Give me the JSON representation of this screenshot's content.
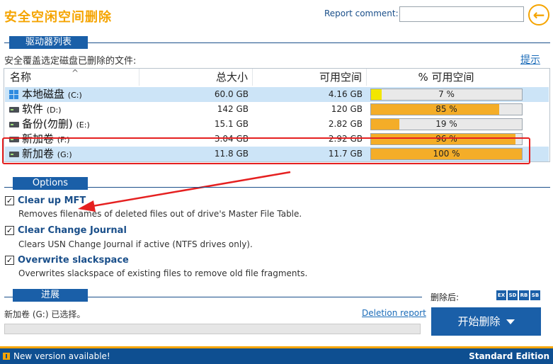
{
  "window": {
    "title": "安全空闲空间删除"
  },
  "report_comment": {
    "label": "Report comment:",
    "value": ""
  },
  "back_button": {
    "icon": "arrow-left-icon",
    "glyph": "←"
  },
  "drives_section": {
    "tab_label": "驱动器列表",
    "subheading": "安全覆盖选定磁盘已删除的文件:",
    "hint_link": "提示",
    "columns": [
      "名称",
      "总大小",
      "可用空间",
      "% 可用空间"
    ],
    "rows": [
      {
        "name": "本地磁盘",
        "letter": "(C:)",
        "total": "60.0 GB",
        "free": "4.16 GB",
        "pct_label": "7 %",
        "pct": 7,
        "bar_color": "#f2e600",
        "icon": "windows-drive-icon",
        "selected": true
      },
      {
        "name": "软件",
        "letter": "(D:)",
        "total": "142 GB",
        "free": "120 GB",
        "pct_label": "85 %",
        "pct": 85,
        "bar_color": "#f4ad28",
        "icon": "drive-icon",
        "selected": false
      },
      {
        "name": "备份(勿删)",
        "letter": "(E:)",
        "total": "15.1 GB",
        "free": "2.82 GB",
        "pct_label": "19 %",
        "pct": 19,
        "bar_color": "#f4ad28",
        "icon": "drive-icon",
        "selected": false
      },
      {
        "name": "新加卷",
        "letter": "(F:)",
        "total": "3.04 GB",
        "free": "2.92 GB",
        "pct_label": "96 %",
        "pct": 96,
        "bar_color": "#f4ad28",
        "icon": "drive-icon",
        "selected": false
      },
      {
        "name": "新加卷",
        "letter": "(G:)",
        "total": "11.8 GB",
        "free": "11.7 GB",
        "pct_label": "100 %",
        "pct": 100,
        "bar_color": "#f4ad28",
        "icon": "drive-icon",
        "selected": true
      }
    ]
  },
  "options_section": {
    "tab_label": "Options",
    "items": [
      {
        "title": "Clear up MFT",
        "desc": "Removes filenames of deleted files out of drive's Master File Table.",
        "checked": "✓"
      },
      {
        "title": "Clear Change Journal",
        "desc": "Clears USN Change Journal if active (NTFS drives only).",
        "checked": "✓"
      },
      {
        "title": "Overwrite slackspace",
        "desc": "Overwrites slackspace of existing files to remove old file fragments.",
        "checked": "✓"
      }
    ]
  },
  "progress_section": {
    "tab_label": "进展",
    "status": "新加卷 (G:) 已选择。",
    "report_link": "Deletion report",
    "progress": 0
  },
  "after_delete": {
    "label": "删除后:",
    "tags": [
      "EX",
      "SD",
      "RB",
      "SB"
    ]
  },
  "start_button": {
    "label": "开始删除"
  },
  "statusbar": {
    "left_text": "New version available!",
    "right_text": "Standard Edition",
    "icon": "update-available-icon"
  },
  "colors": {
    "accent": "#f5a400",
    "brand_blue": "#1a5fa8",
    "highlight_row": "#cce4f7",
    "annotation_red": "#e52020"
  }
}
